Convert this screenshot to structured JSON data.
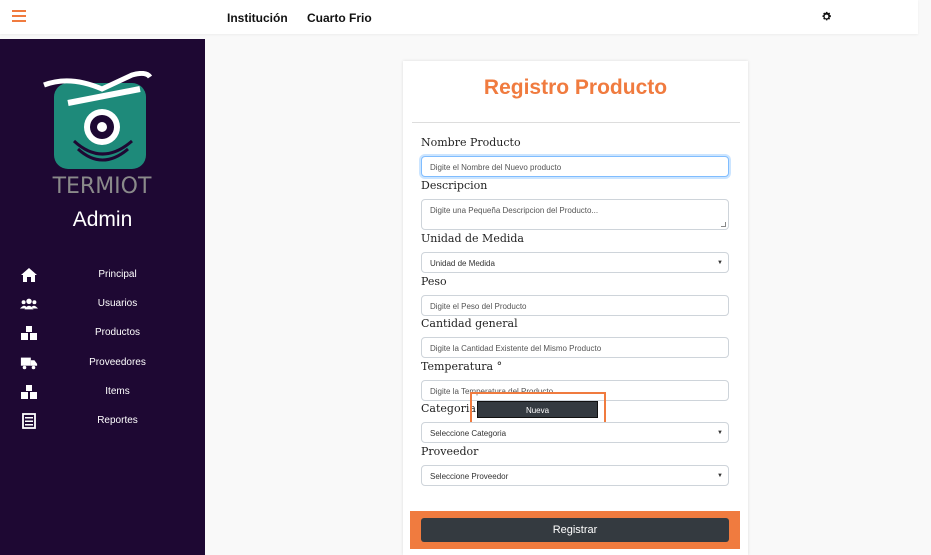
{
  "topbar": {
    "menu_icon": "hamburger-icon",
    "links": [
      "Institución",
      "Cuarto Frio"
    ],
    "settings_icon": "gear-icon"
  },
  "sidebar": {
    "logo_text": "TERMIOT",
    "role": "Admin",
    "items": [
      {
        "label": "Principal",
        "icon": "home-icon"
      },
      {
        "label": "Usuarios",
        "icon": "users-icon"
      },
      {
        "label": "Productos",
        "icon": "boxes-icon"
      },
      {
        "label": "Proveedores",
        "icon": "truck-icon"
      },
      {
        "label": "Items",
        "icon": "boxes-icon"
      },
      {
        "label": "Reportes",
        "icon": "clipboard-icon"
      }
    ]
  },
  "form": {
    "title": "Registro Producto",
    "fields": {
      "nombre": {
        "label": "Nombre Producto",
        "placeholder": "Digite el Nombre del Nuevo producto"
      },
      "descripcion": {
        "label": "Descripcion",
        "placeholder": "Digite una Pequeña Descripcion del Producto..."
      },
      "unidad": {
        "label": "Unidad de Medida",
        "value": "Unidad de Medida"
      },
      "peso": {
        "label": "Peso",
        "placeholder": "Digite el Peso del Producto"
      },
      "cantidad": {
        "label": "Cantidad general",
        "placeholder": "Digite la Cantidad Existente del Mismo Producto"
      },
      "temperatura": {
        "label": "Temperatura °",
        "placeholder": "Digite la Temperatura del Producto"
      },
      "categoria": {
        "label": "Categoria",
        "value": "Seleccione Categoria",
        "new_button": "Nueva"
      },
      "proveedor": {
        "label": "Proveedor",
        "value": "Seleccione Proveedor"
      }
    },
    "submit_label": "Registrar"
  },
  "colors": {
    "accent": "#f07b3f",
    "sidebar_bg": "#1e0833",
    "button_dark": "#343a40",
    "logo_teal": "#1e8a7a"
  }
}
